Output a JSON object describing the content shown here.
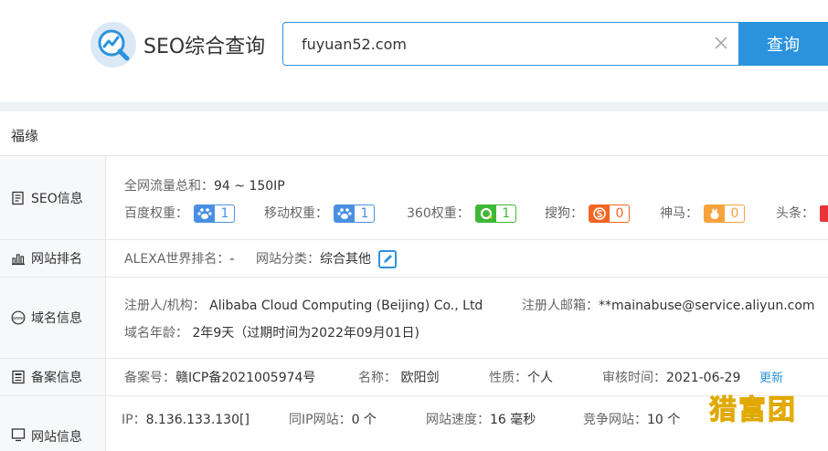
{
  "header": {
    "brand": "SEO综合查询",
    "search_value": "fuyuan52.com",
    "search_button": "查询"
  },
  "site_name": "福缘",
  "rows": {
    "seo": {
      "label": "SEO信息",
      "traffic_label": "全网流量总和：",
      "traffic_value": "94 ~ 150IP",
      "baidu_label": "百度权重：",
      "baidu_value": "1",
      "mobile_label": "移动权重：",
      "mobile_value": "1",
      "so360_label": "360权重：",
      "so360_value": "1",
      "sogou_label": "搜狗：",
      "sogou_value": "0",
      "shenma_label": "神马：",
      "shenma_value": "0",
      "toutiao_label": "头条："
    },
    "rank": {
      "label": "网站排名",
      "alexa_label": "ALEXA世界排名：",
      "alexa_value": "-",
      "category_label": "网站分类：",
      "category_value": "综合其他"
    },
    "domain": {
      "label": "域名信息",
      "registrant_label": "注册人/机构：",
      "registrant_value": "Alibaba Cloud Computing (Beijing) Co., Ltd",
      "email_label": "注册人邮箱：",
      "email_value": "**mainabuse@service.aliyun.com",
      "age_label": "域名年龄：",
      "age_value": "2年9天（过期时间为2022年09月01日)"
    },
    "icp": {
      "label": "备案信息",
      "icp_label": "备案号：",
      "icp_value": "赣ICP备2021005974号",
      "name_label": "名称：",
      "name_value": "欧阳剑",
      "nature_label": "性质：",
      "nature_value": "个人",
      "audit_label": "审核时间：",
      "audit_value": "2021-06-29",
      "update_link": "更新"
    },
    "site": {
      "label": "网站信息",
      "ip_label": "IP：",
      "ip_value": "8.136.133.130[]",
      "sameip_label": "同IP网站：",
      "sameip_value": "0 个",
      "speed_label": "网站速度：",
      "speed_value": "16 毫秒",
      "competitor_label": "竞争网站：",
      "competitor_value": "10 个"
    }
  },
  "watermark": "猎富团",
  "colors": {
    "accent": "#2b93dd",
    "baidu": "#4a90e2",
    "so360": "#3fb837",
    "sogou": "#f26522",
    "shenma": "#f7a23b"
  }
}
